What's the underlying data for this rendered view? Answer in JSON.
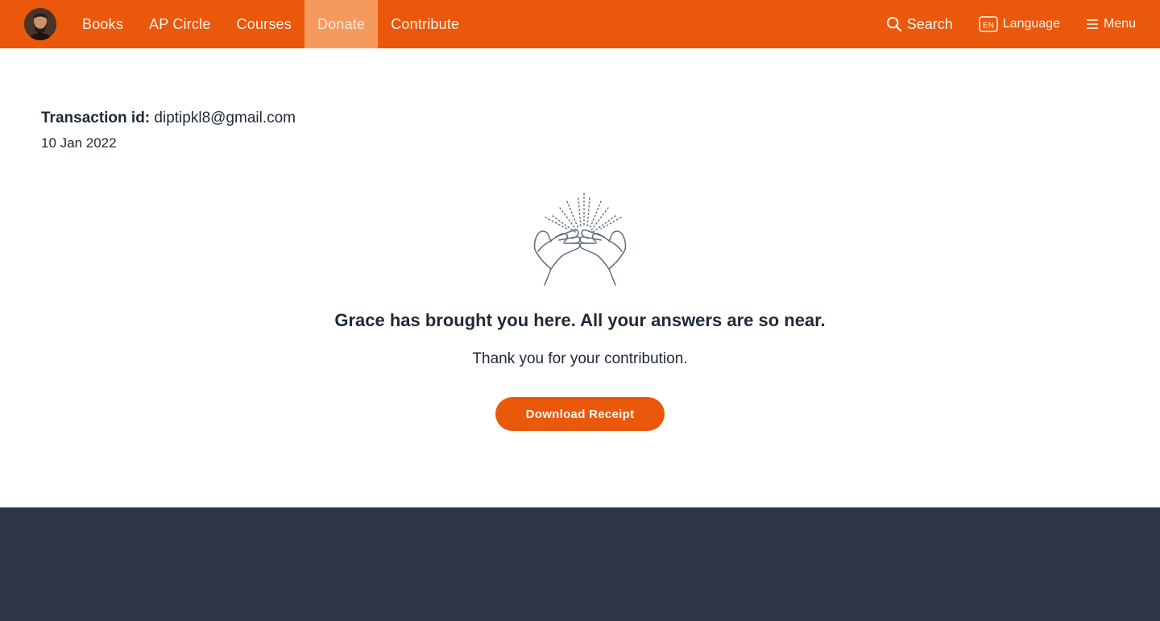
{
  "nav": {
    "items": [
      {
        "label": "Books"
      },
      {
        "label": "AP Circle"
      },
      {
        "label": "Courses"
      },
      {
        "label": "Donate",
        "active": true
      },
      {
        "label": "Contribute"
      }
    ],
    "search_label": "Search",
    "language_badge": "EN",
    "language_label": "Language",
    "menu_label": "Menu",
    "icons": {
      "avatar": "profile-avatar",
      "search": "search-icon",
      "language": "language-icon",
      "menu": "hamburger-menu-icon"
    }
  },
  "transaction": {
    "label": "Transaction id:",
    "value": "diptipkl8@gmail.com",
    "date": "10 Jan 2022"
  },
  "message": {
    "headline": "Grace has brought you here. All your answers are so near.",
    "subline": "Thank you for your contribution.",
    "download_label": "Download Receipt",
    "illustration": "praying-hands-icon"
  },
  "colors": {
    "brand": "#ea580c",
    "nav_active": "#f59a5c",
    "text": "#1f2937",
    "footer": "#2e3648"
  }
}
